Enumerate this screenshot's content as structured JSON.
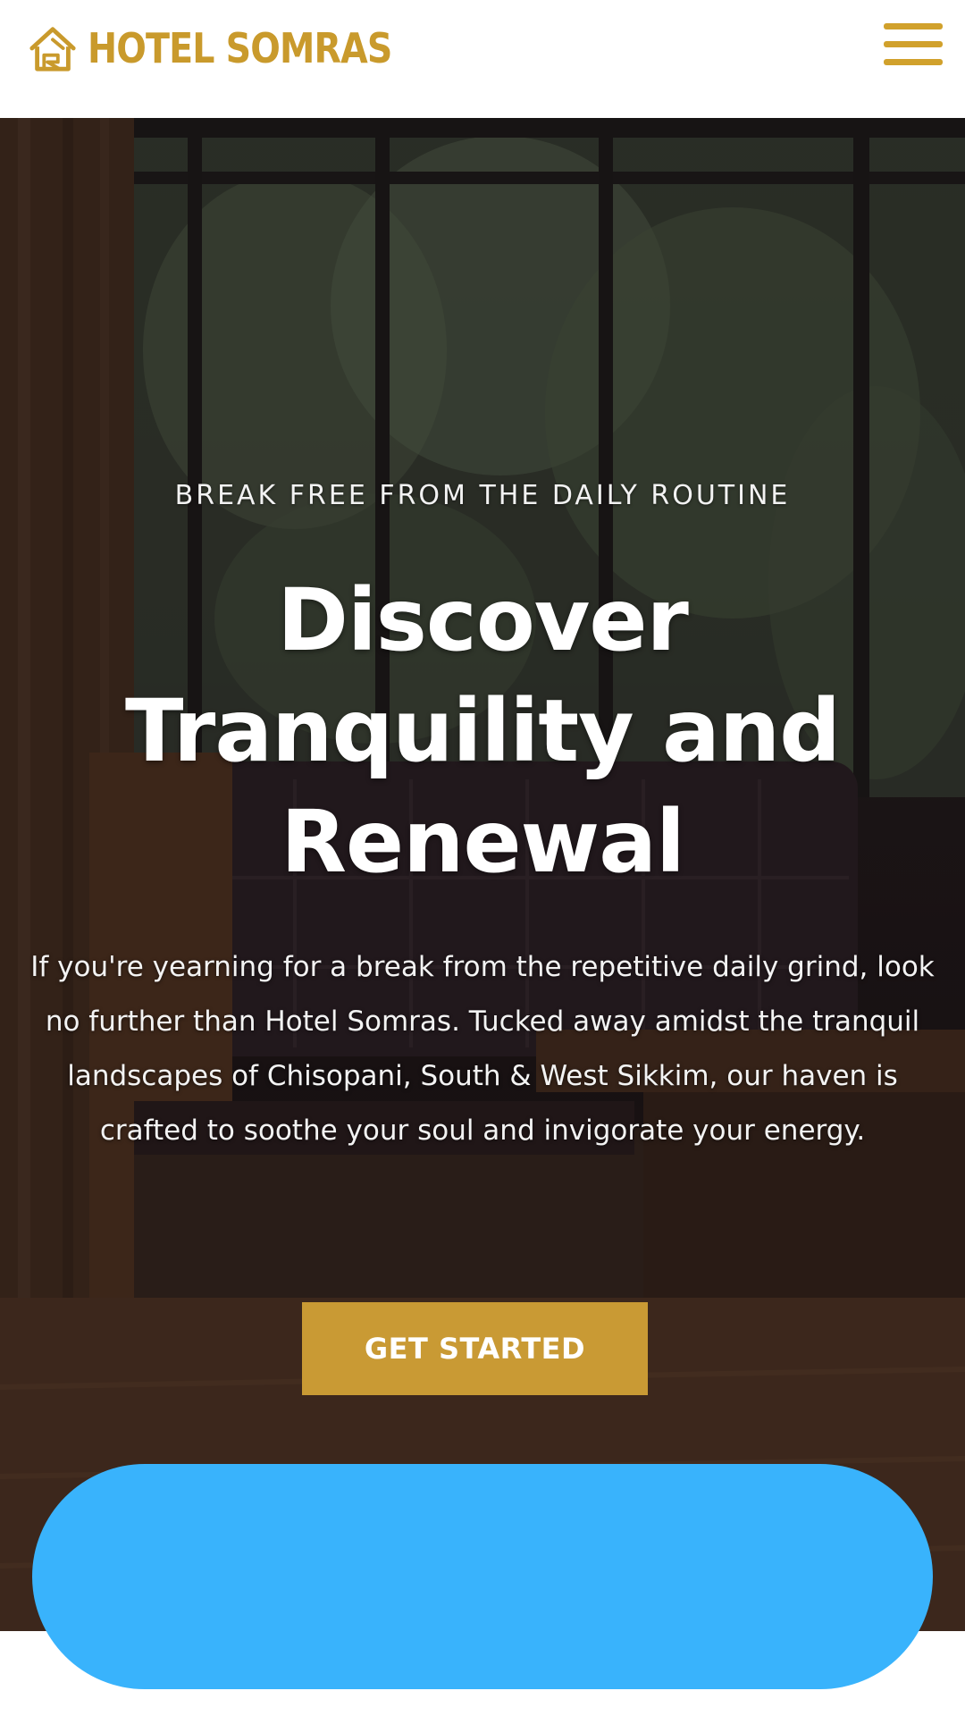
{
  "brand": {
    "name": "HOTEL SOMRAS",
    "logo_icon": "house-logo-icon",
    "color": "#c99a2c"
  },
  "header": {
    "menu_icon": "hamburger-menu-icon",
    "menu_color": "#d1a12c"
  },
  "hero": {
    "eyebrow": "BREAK FREE FROM THE DAILY ROUTINE",
    "title": "Discover Tranquility and Renewal",
    "description": "If you're yearning for a break from the repetitive daily grind, look no further than Hotel Somras. Tucked away amidst the tranquil landscapes of Chisopani, South & West Sikkim, our haven is crafted to soothe your soul and invigorate your energy.",
    "cta_label": "GET STARTED",
    "cta_color": "#c99a34"
  },
  "overlay": {
    "color": "#39b3fc"
  }
}
